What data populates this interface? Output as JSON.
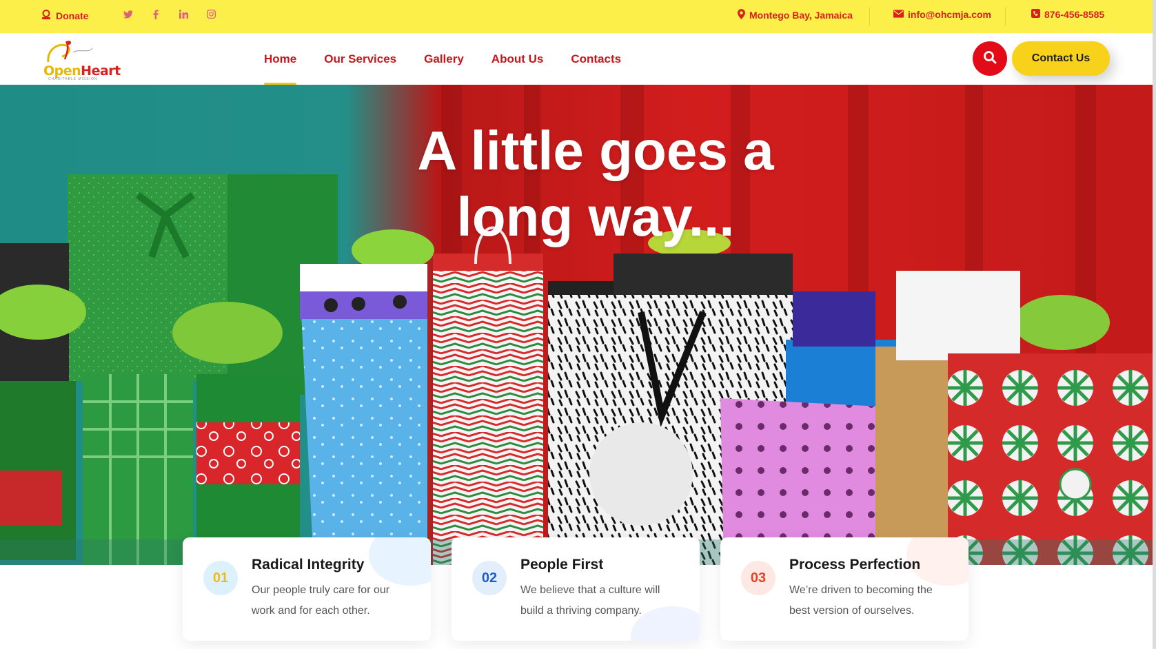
{
  "topbar": {
    "donate_label": "Donate",
    "location": "Montego Bay, Jamaica",
    "email": "info@ohcmja.com",
    "phone": "876-456-8585",
    "social_icons": [
      "twitter-icon",
      "facebook-icon",
      "linkedin-icon",
      "instagram-icon"
    ]
  },
  "header": {
    "logo_text_a": "Open",
    "logo_text_b": "Heart",
    "logo_sub": "CHARITABLE MISSION",
    "nav": [
      {
        "label": "Home",
        "active": true
      },
      {
        "label": "Our Services",
        "active": false
      },
      {
        "label": "Gallery",
        "active": false
      },
      {
        "label": "About Us",
        "active": false
      },
      {
        "label": "Contacts",
        "active": false
      }
    ],
    "contact_label": "Contact Us"
  },
  "hero": {
    "title_line1": "A little goes a",
    "title_line2": "long way..."
  },
  "cards": [
    {
      "num": "01",
      "title": "Radical Integrity",
      "line1": "Our people truly care for our",
      "line2": "work and for each other."
    },
    {
      "num": "02",
      "title": "People First",
      "line1": "We believe that a culture will",
      "line2": "build a thriving company."
    },
    {
      "num": "03",
      "title": "Process Perfection",
      "line1": "We’re driven to becoming the",
      "line2": "best version of ourselves."
    }
  ],
  "colors": {
    "accent_red": "#c8161d",
    "accent_yellow": "#f8d21a",
    "topbar_yellow": "#fcef4a"
  }
}
